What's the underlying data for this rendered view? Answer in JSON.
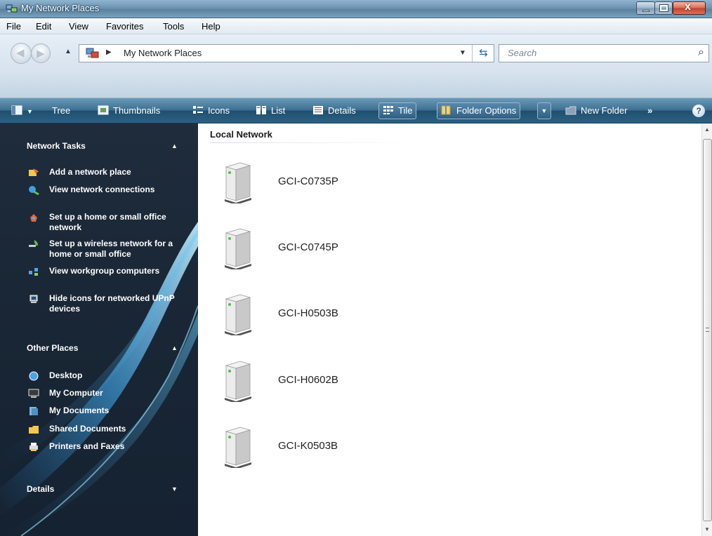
{
  "window": {
    "title": "My Network Places"
  },
  "menu": [
    "File",
    "Edit",
    "View",
    "Favorites",
    "Tools",
    "Help"
  ],
  "address": {
    "path": "My Network Places",
    "search_placeholder": "Search"
  },
  "toolbar": {
    "tree": "Tree",
    "thumbnails": "Thumbnails",
    "icons": "Icons",
    "list": "List",
    "details": "Details",
    "tile": "Tile",
    "folder_options": "Folder Options",
    "new_folder": "New Folder",
    "more": "»",
    "help": "?"
  },
  "sidebar": {
    "network_tasks": {
      "title": "Network Tasks",
      "items": [
        {
          "label": "Add a network place",
          "icon": "add-network-place-icon"
        },
        {
          "label": "View network connections",
          "icon": "network-connections-icon"
        },
        {
          "label": "Set up a home or small office network",
          "icon": "home-network-icon"
        },
        {
          "label": "Set up a wireless network for a home or small office",
          "icon": "wireless-network-icon"
        },
        {
          "label": "View workgroup computers",
          "icon": "workgroup-icon"
        },
        {
          "label": "Hide icons for networked UPnP devices",
          "icon": "upnp-device-icon"
        }
      ]
    },
    "other_places": {
      "title": "Other Places",
      "items": [
        {
          "label": "Desktop",
          "icon": "desktop-icon"
        },
        {
          "label": "My Computer",
          "icon": "my-computer-icon"
        },
        {
          "label": "My Documents",
          "icon": "my-documents-icon"
        },
        {
          "label": "Shared Documents",
          "icon": "shared-documents-icon"
        },
        {
          "label": "Printers and Faxes",
          "icon": "printers-icon"
        }
      ]
    },
    "details": {
      "title": "Details"
    }
  },
  "main": {
    "group": "Local Network",
    "computers": [
      "GCI-C0735P",
      "GCI-C0745P",
      "GCI-H0503B",
      "GCI-H0602B",
      "GCI-K0503B"
    ]
  },
  "colors": {
    "toolbar": "#2c6184",
    "sidebar": "#1a2736",
    "accent": "#6fc3ff"
  }
}
